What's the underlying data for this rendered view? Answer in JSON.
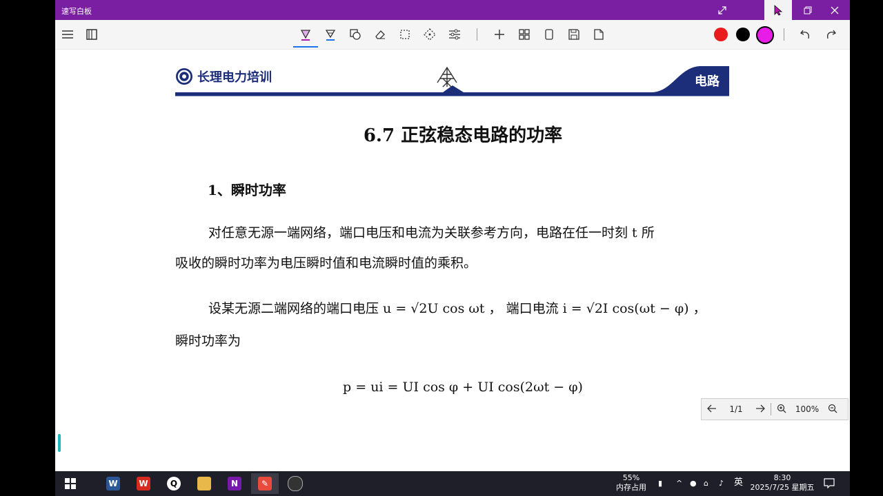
{
  "window": {
    "title": "速写白板"
  },
  "toolbar": {
    "colors": [
      "#e81c1c",
      "#000000",
      "#e81ce8"
    ]
  },
  "document": {
    "brand": "长理电力培训",
    "section_tab": "电路",
    "title": "6.7  正弦稳态电路的功率",
    "heading": "1、瞬时功率",
    "para1_line1": "对任意无源一端网络，端口电压和电流为关联参考方向，电路在任一时刻 t 所",
    "para1_line2": "吸收的瞬时功率为电压瞬时值和电流瞬时值的乘积。",
    "para2_line1": "设某无源二端网络的端口电压 u = √2U cos ωt ， 端口电流 i = √2I cos(ωt − φ) ，",
    "para2_line2": "瞬时功率为",
    "formula": "p = ui = UI cos φ + UI cos(2ωt − φ)"
  },
  "page_nav": {
    "page": "1/1",
    "zoom": "100%"
  },
  "taskbar": {
    "memory_percent": "55%",
    "memory_label": "内存占用",
    "ime": "英",
    "time": "8:30",
    "date": "2025/7/25 星期五"
  }
}
